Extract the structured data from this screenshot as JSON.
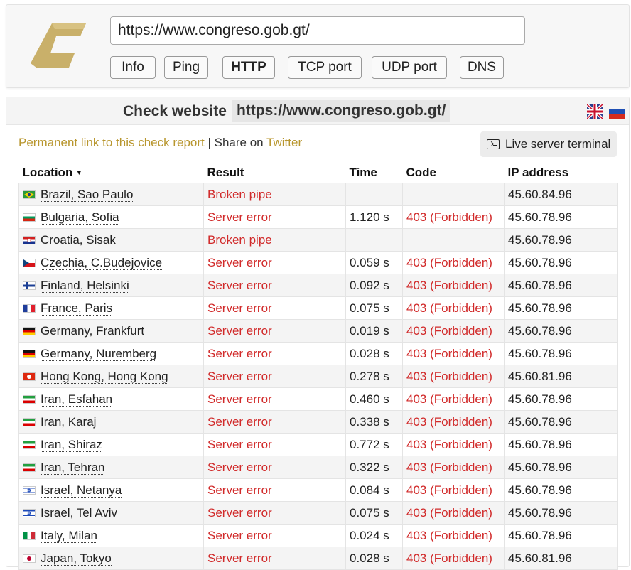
{
  "header": {
    "url_value": "https://www.congreso.gob.gt/",
    "tabs": [
      {
        "label": "Info",
        "active": false
      },
      {
        "label": "Ping",
        "active": false
      },
      {
        "label": "HTTP",
        "active": true
      },
      {
        "label": "TCP port",
        "active": false
      },
      {
        "label": "UDP port",
        "active": false
      },
      {
        "label": "DNS",
        "active": false
      }
    ]
  },
  "check": {
    "label": "Check website",
    "url": "https://www.congreso.gob.gt/",
    "permanent_link": "Permanent link to this check report",
    "separator": "|",
    "share_text": "Share on",
    "twitter": "Twitter",
    "terminal_label": "Live server terminal"
  },
  "table": {
    "headers": {
      "location": "Location",
      "result": "Result",
      "time": "Time",
      "code": "Code",
      "ip": "IP address"
    },
    "sort_indicator": "▼",
    "rows": [
      {
        "flag": "br",
        "location": "Brazil, Sao Paulo",
        "result": "Broken pipe",
        "time": "",
        "code": "",
        "ip": "45.60.84.96"
      },
      {
        "flag": "bg",
        "location": "Bulgaria, Sofia",
        "result": "Server error",
        "time": "1.120 s",
        "code": "403 (Forbidden)",
        "ip": "45.60.78.96"
      },
      {
        "flag": "hr",
        "location": "Croatia, Sisak",
        "result": "Broken pipe",
        "time": "",
        "code": "",
        "ip": "45.60.78.96"
      },
      {
        "flag": "cz",
        "location": "Czechia, C.Budejovice",
        "result": "Server error",
        "time": "0.059 s",
        "code": "403 (Forbidden)",
        "ip": "45.60.78.96"
      },
      {
        "flag": "fi",
        "location": "Finland, Helsinki",
        "result": "Server error",
        "time": "0.092 s",
        "code": "403 (Forbidden)",
        "ip": "45.60.78.96"
      },
      {
        "flag": "fr",
        "location": "France, Paris",
        "result": "Server error",
        "time": "0.075 s",
        "code": "403 (Forbidden)",
        "ip": "45.60.78.96"
      },
      {
        "flag": "de",
        "location": "Germany, Frankfurt",
        "result": "Server error",
        "time": "0.019 s",
        "code": "403 (Forbidden)",
        "ip": "45.60.78.96"
      },
      {
        "flag": "de",
        "location": "Germany, Nuremberg",
        "result": "Server error",
        "time": "0.028 s",
        "code": "403 (Forbidden)",
        "ip": "45.60.78.96"
      },
      {
        "flag": "hk",
        "location": "Hong Kong, Hong Kong",
        "result": "Server error",
        "time": "0.278 s",
        "code": "403 (Forbidden)",
        "ip": "45.60.81.96"
      },
      {
        "flag": "ir",
        "location": "Iran, Esfahan",
        "result": "Server error",
        "time": "0.460 s",
        "code": "403 (Forbidden)",
        "ip": "45.60.78.96"
      },
      {
        "flag": "ir",
        "location": "Iran, Karaj",
        "result": "Server error",
        "time": "0.338 s",
        "code": "403 (Forbidden)",
        "ip": "45.60.78.96"
      },
      {
        "flag": "ir",
        "location": "Iran, Shiraz",
        "result": "Server error",
        "time": "0.772 s",
        "code": "403 (Forbidden)",
        "ip": "45.60.78.96"
      },
      {
        "flag": "ir",
        "location": "Iran, Tehran",
        "result": "Server error",
        "time": "0.322 s",
        "code": "403 (Forbidden)",
        "ip": "45.60.78.96"
      },
      {
        "flag": "il",
        "location": "Israel, Netanya",
        "result": "Server error",
        "time": "0.084 s",
        "code": "403 (Forbidden)",
        "ip": "45.60.78.96"
      },
      {
        "flag": "il",
        "location": "Israel, Tel Aviv",
        "result": "Server error",
        "time": "0.075 s",
        "code": "403 (Forbidden)",
        "ip": "45.60.78.96"
      },
      {
        "flag": "it",
        "location": "Italy, Milan",
        "result": "Server error",
        "time": "0.024 s",
        "code": "403 (Forbidden)",
        "ip": "45.60.78.96"
      },
      {
        "flag": "jp",
        "location": "Japan, Tokyo",
        "result": "Server error",
        "time": "0.028 s",
        "code": "403 (Forbidden)",
        "ip": "45.60.81.96"
      }
    ]
  },
  "colors": {
    "accent_gold": "#b8962e",
    "error_red": "#d12a2a"
  }
}
